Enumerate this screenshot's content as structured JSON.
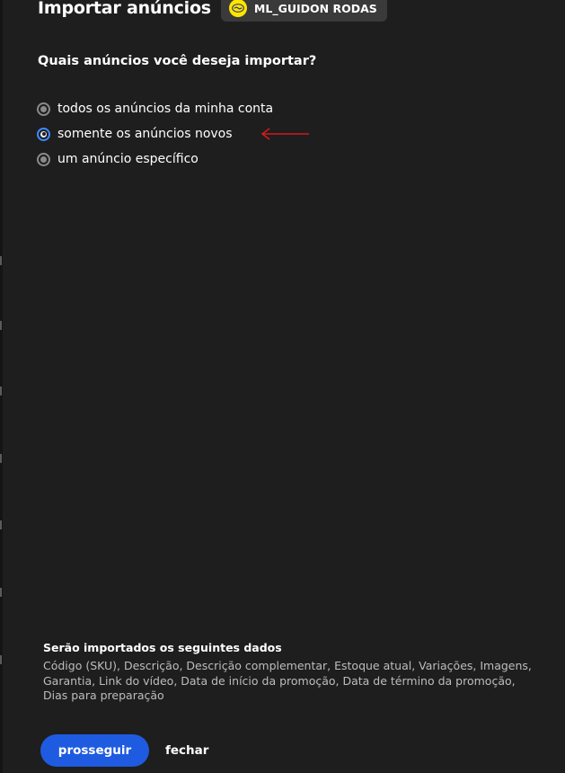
{
  "header": {
    "title": "Importar anúncios",
    "account": {
      "name": "ML_GUIDON RODAS",
      "icon": "handshake-icon",
      "icon_color": "#ffe600"
    }
  },
  "form": {
    "question": "Quais anúncios você deseja importar?",
    "options": [
      {
        "label": "todos os anúncios da minha conta",
        "selected": false
      },
      {
        "label": "somente os anúncios novos",
        "selected": true
      },
      {
        "label": "um anúncio específico",
        "selected": false
      }
    ]
  },
  "annotation": {
    "type": "red-arrow-pointing-left",
    "color": "#d11a1a"
  },
  "info": {
    "title": "Serão importados os seguintes dados",
    "lines": [
      "Código (SKU), Descrição, Descrição complementar, Estoque atual, Variações, Imagens,",
      "Garantia, Link do vídeo, Data de início da promoção, Data de término da promoção,",
      "Dias para preparação"
    ]
  },
  "actions": {
    "proceed_label": "prosseguir",
    "close_label": "fechar"
  },
  "colors": {
    "background": "#1e1e1e",
    "primary": "#1f5be0",
    "radio_selected": "#3d8bff"
  }
}
